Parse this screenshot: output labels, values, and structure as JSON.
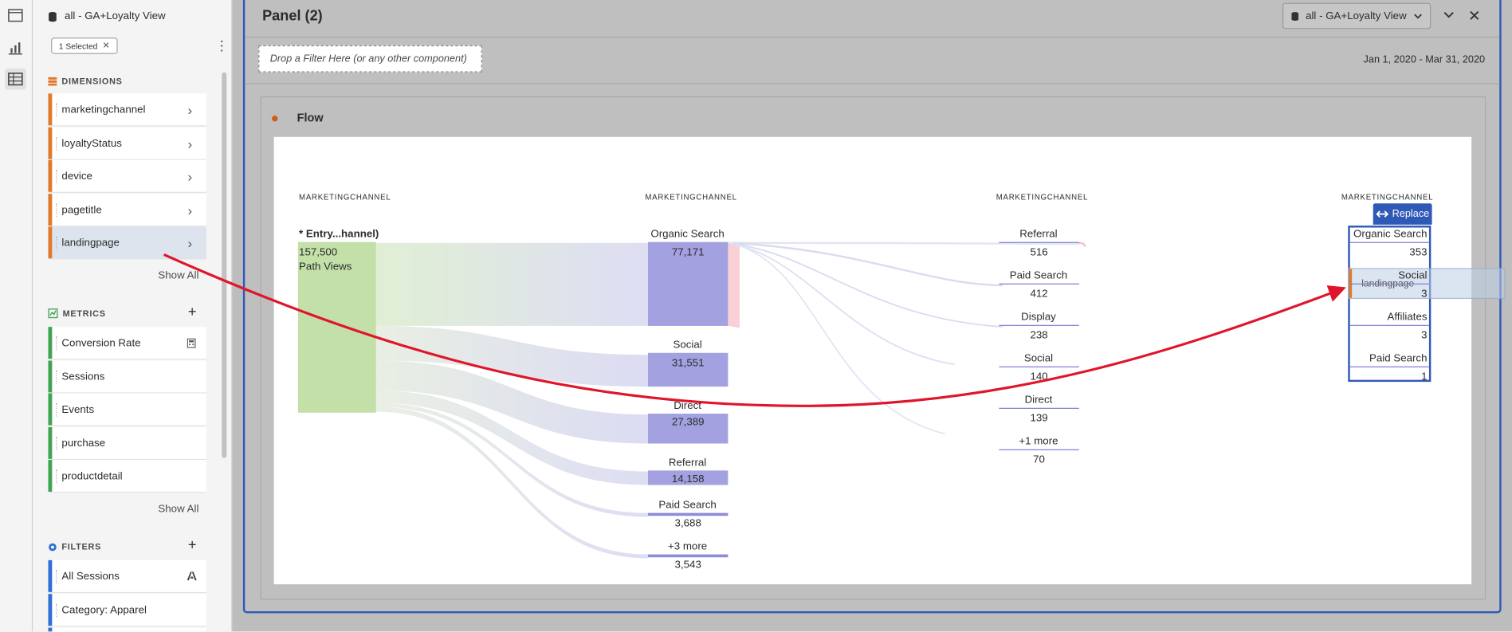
{
  "rail": {
    "icons": [
      "panel-icon",
      "visualization-icon",
      "components-icon"
    ]
  },
  "left_panel": {
    "dataview_title": "all - GA+Loyalty View",
    "selected_badge": "1 Selected",
    "dimensions": {
      "heading": "DIMENSIONS",
      "items": [
        {
          "label": "marketingchannel"
        },
        {
          "label": "loyaltyStatus"
        },
        {
          "label": "device"
        },
        {
          "label": "pagetitle"
        },
        {
          "label": "landingpage"
        }
      ],
      "show_all": "Show All"
    },
    "metrics": {
      "heading": "METRICS",
      "items": [
        {
          "label": "Conversion Rate"
        },
        {
          "label": "Sessions"
        },
        {
          "label": "Events"
        },
        {
          "label": "purchase"
        },
        {
          "label": "productdetail"
        }
      ],
      "show_all": "Show All"
    },
    "filters": {
      "heading": "FILTERS",
      "items": [
        {
          "label": "All Sessions"
        },
        {
          "label": "Category: Apparel"
        }
      ]
    }
  },
  "panel": {
    "title": "Panel (2)",
    "dataview_selector": "all - GA+Loyalty View",
    "drop_zone": "Drop a Filter Here (or any other component)",
    "date_range": "Jan 1, 2020 - Mar 31, 2020",
    "viz_title": "Flow"
  },
  "flow": {
    "columns": [
      {
        "header": "MARKETINGCHANNEL",
        "nodes": [
          {
            "label": "* Entry...hannel)",
            "value": "157,500",
            "sub": "Path Views"
          }
        ]
      },
      {
        "header": "MARKETINGCHANNEL",
        "nodes": [
          {
            "label": "Organic Search",
            "value": "77,171"
          },
          {
            "label": "Social",
            "value": "31,551"
          },
          {
            "label": "Direct",
            "value": "27,389"
          },
          {
            "label": "Referral",
            "value": "14,158"
          },
          {
            "label": "Paid Search",
            "value": "3,688"
          },
          {
            "label": "+3 more",
            "value": "3,543"
          }
        ]
      },
      {
        "header": "MARKETINGCHANNEL",
        "nodes": [
          {
            "label": "Referral",
            "value": "516"
          },
          {
            "label": "Paid Search",
            "value": "412"
          },
          {
            "label": "Display",
            "value": "238"
          },
          {
            "label": "Social",
            "value": "140"
          },
          {
            "label": "Direct",
            "value": "139"
          },
          {
            "label": "+1 more",
            "value": "70"
          }
        ]
      },
      {
        "header": "MARKETINGCHANNEL",
        "nodes": [
          {
            "label": "Organic Search",
            "value": "353"
          },
          {
            "label": "Social",
            "value": "3"
          },
          {
            "label": "Affiliates",
            "value": "3"
          },
          {
            "label": "Paid Search",
            "value": "1"
          }
        ]
      }
    ],
    "replace_button": "Replace",
    "drag_ghost": "landingpage"
  },
  "colors": {
    "dimension": "#e07a2a",
    "metric": "#3fa452",
    "filter": "#2f6fd6",
    "entry_node": "#c3e0a8",
    "node": "#a3a1e0",
    "accent_blue": "#2f59b7",
    "drag_arrow": "#e0152b"
  }
}
